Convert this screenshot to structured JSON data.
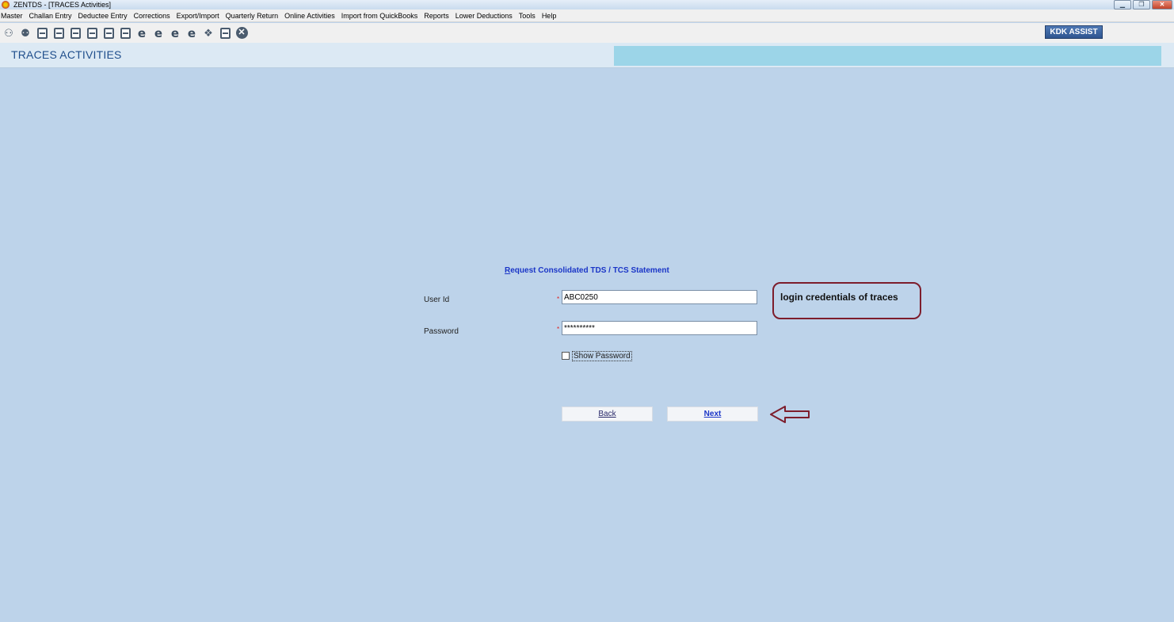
{
  "window": {
    "title": "ZENTDS - [TRACES Activities]",
    "min": "▁",
    "max": "❐",
    "close": "✕"
  },
  "menu": [
    "Master",
    "Challan Entry",
    "Deductee Entry",
    "Corrections",
    "Export/Import",
    "Quarterly Return",
    "Online Activities",
    "Import from QuickBooks",
    "Reports",
    "Lower Deductions",
    "Tools",
    "Help"
  ],
  "toolbar": {
    "icons": [
      "masters-icon",
      "deductees-icon",
      "challan-icon",
      "return-icon",
      "form-24q-icon",
      "form-26q-icon",
      "form-27q-icon",
      "form-27eq-icon",
      "etds-24q-icon",
      "etds-26q-icon",
      "etds-27q-icon",
      "etds-27eq-icon",
      "tds-icon",
      "document-icon",
      "exit-icon"
    ],
    "kdk_assist": "KDK ASSIST"
  },
  "header": {
    "title": "TRACES ACTIVITIES"
  },
  "form": {
    "title": "Request Consolidated TDS / TCS Statement",
    "user_id_label": "User Id",
    "user_id_value": "ABC0250",
    "password_label": "Password",
    "password_value": "**********",
    "required_mark": "*",
    "show_password_label": "Show Password",
    "back_label": "Back",
    "next_label": "Next"
  },
  "annotation": {
    "callout": "login credentials of traces"
  }
}
